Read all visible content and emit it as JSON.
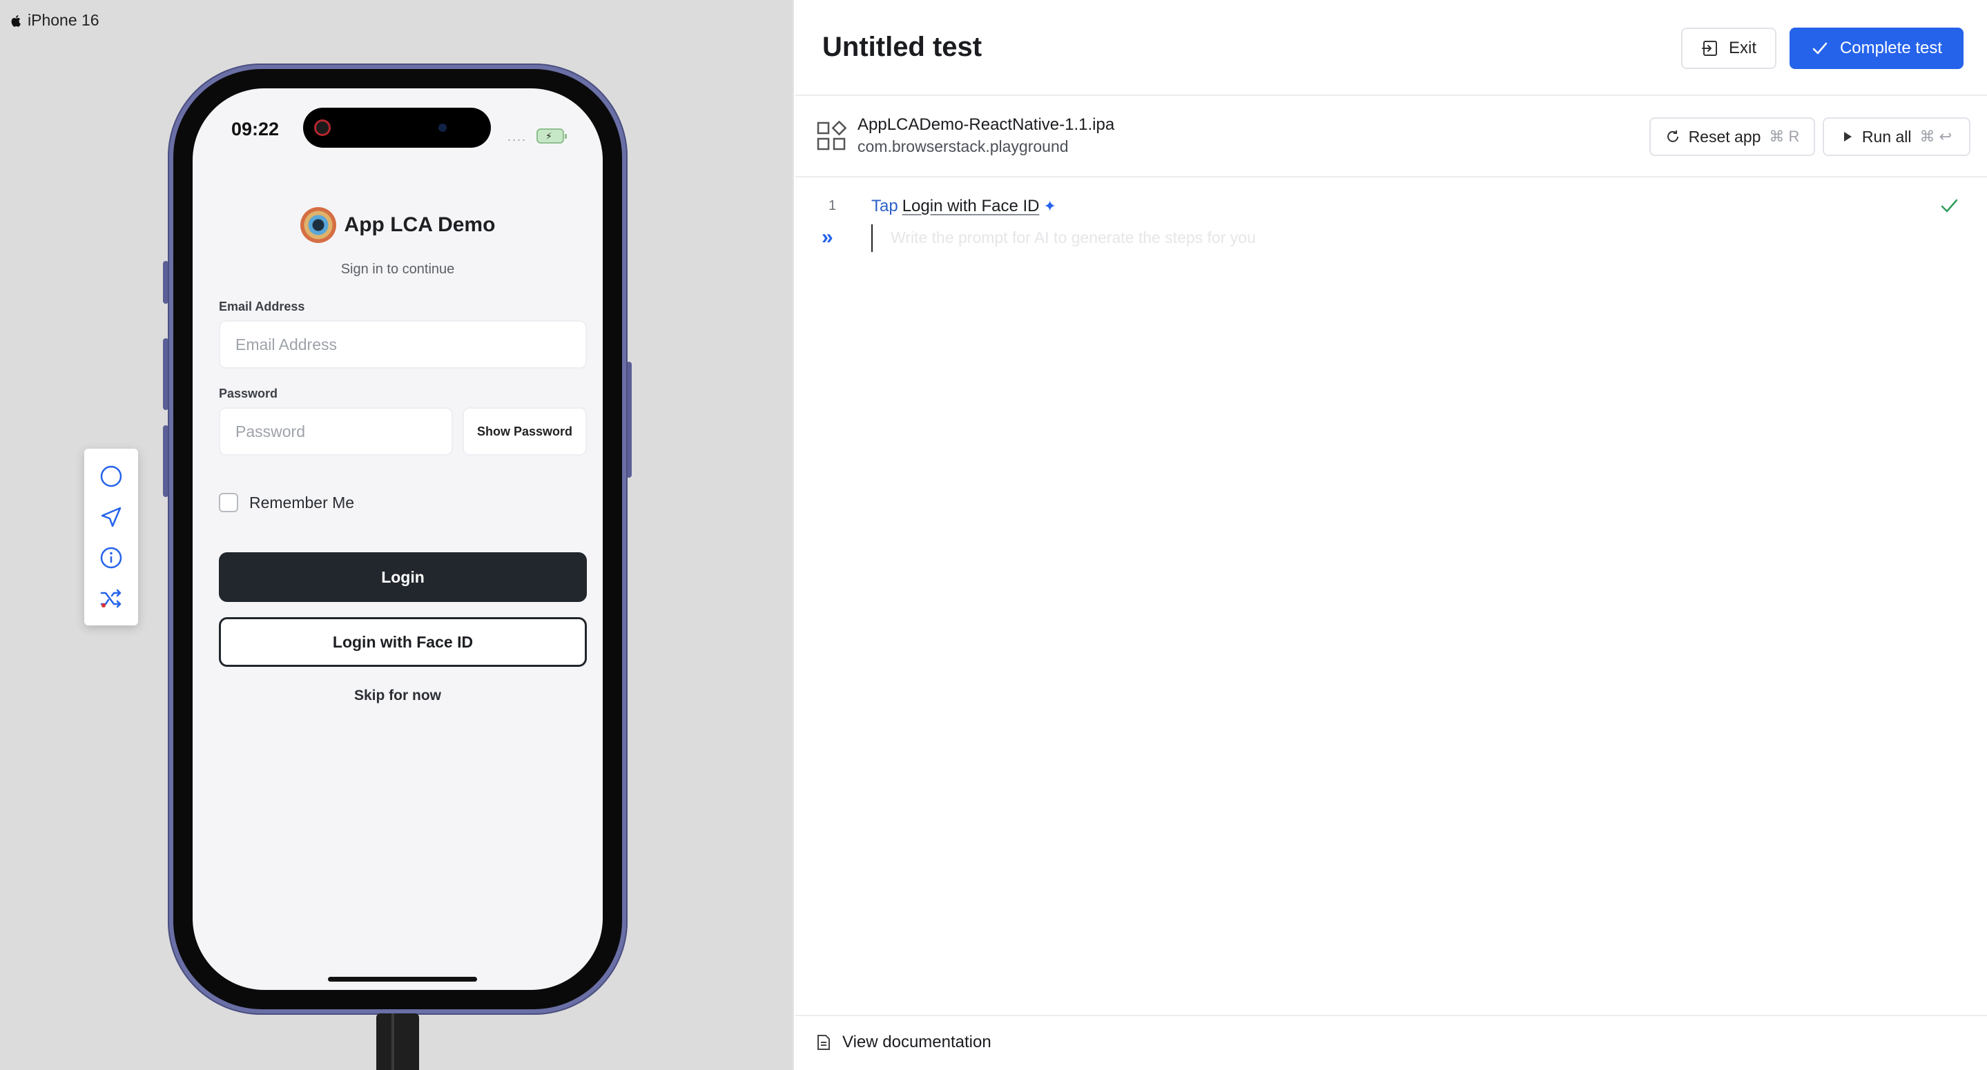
{
  "device": {
    "label": "iPhone 16",
    "icon": "apple-icon"
  },
  "phone": {
    "status_time": "09:22",
    "signal": "....",
    "battery_color": "#c7e8c7",
    "app_title": "App LCA Demo",
    "app_subtitle": "Sign in to continue",
    "email_label": "Email Address",
    "email_placeholder": "Email Address",
    "password_label": "Password",
    "password_placeholder": "Password",
    "show_password_label": "Show Password",
    "remember_label": "Remember Me",
    "login_label": "Login",
    "faceid_label": "Login with Face ID",
    "skip_label": "Skip for now"
  },
  "toolbar": {
    "tools": [
      {
        "icon": "circle-home-icon"
      },
      {
        "icon": "location-arrow-icon"
      },
      {
        "icon": "info-icon"
      },
      {
        "icon": "shuffle-icon"
      }
    ]
  },
  "header": {
    "title": "Untitled test",
    "exit_label": "Exit",
    "complete_label": "Complete test"
  },
  "app_info": {
    "name": "AppLCADemo-ReactNative-1.1.ipa",
    "bundle": "com.browserstack.playground",
    "reset_label": "Reset app",
    "reset_shortcut": "⌘ R",
    "run_label": "Run all",
    "run_shortcut": "⌘ ↩"
  },
  "editor": {
    "steps": [
      {
        "number": "1",
        "verb": "Tap",
        "target": "Login with Face ID",
        "status": "passed"
      }
    ],
    "prompt_placeholder": "Write the prompt for AI to generate the steps for you"
  },
  "footer": {
    "doc_label": "View documentation"
  },
  "colors": {
    "accent": "#2563eb",
    "success": "#2f9e5b",
    "dark_button": "#22262d"
  }
}
